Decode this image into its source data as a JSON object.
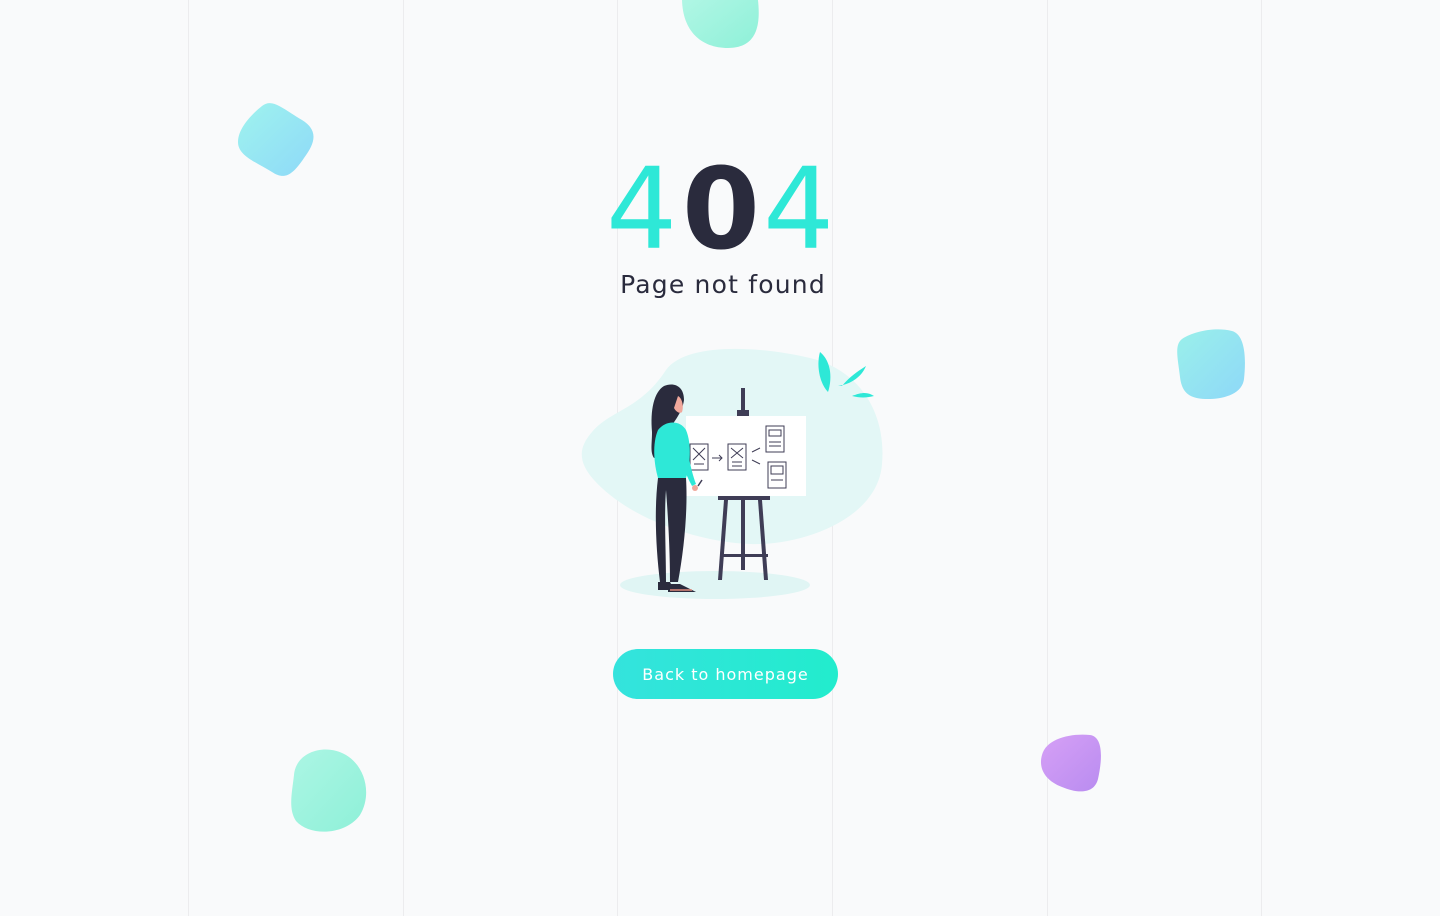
{
  "error": {
    "code_digits": [
      "4",
      "0",
      "4"
    ],
    "message": "Page not found"
  },
  "actions": {
    "home_button_label": "Back to homepage"
  },
  "colors": {
    "accent": "#2ee8d7",
    "dark_text": "#2a2b3d",
    "background": "#f9fafb",
    "grid_line": "#ececee",
    "blob_teal": "#a0f5e4",
    "blob_blue": "#8ee3f8",
    "blob_purple": "#c48bf0"
  },
  "illustration": {
    "subject": "woman-at-easel-with-wireframes-icon"
  }
}
